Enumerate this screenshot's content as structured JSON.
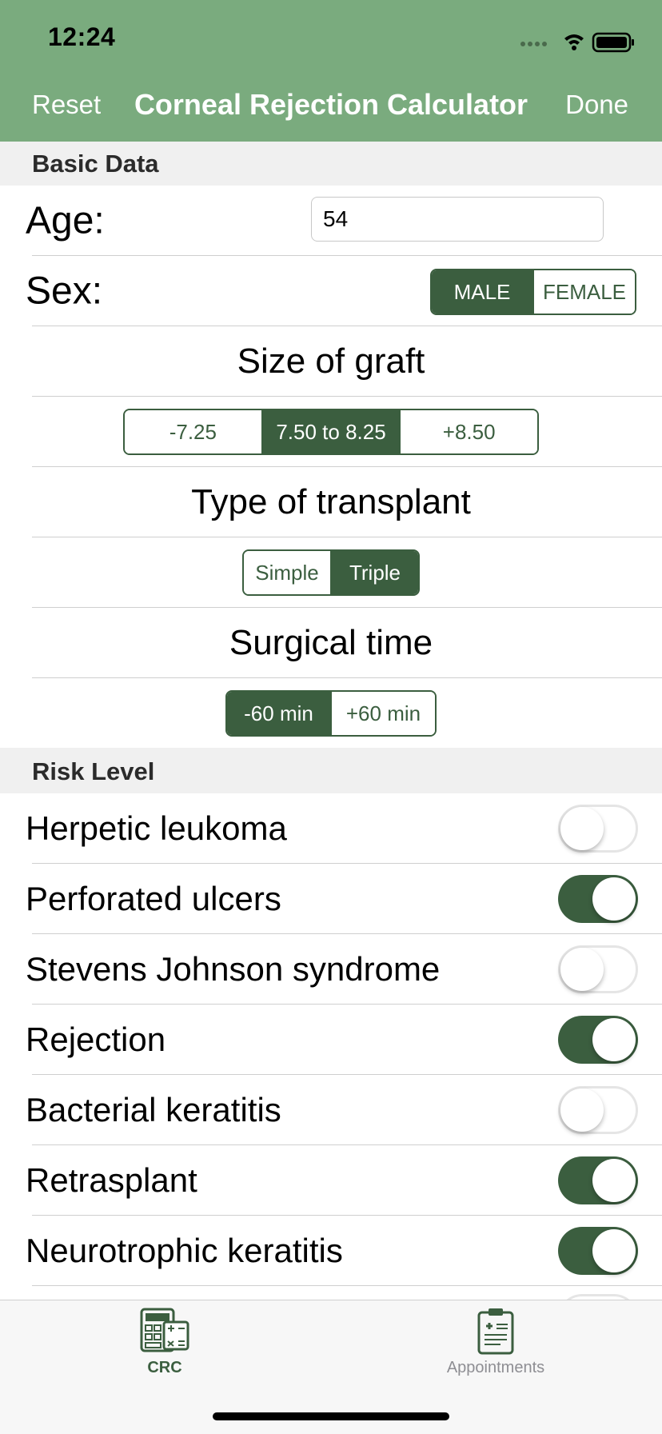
{
  "status_bar": {
    "time": "12:24"
  },
  "nav": {
    "reset_label": "Reset",
    "title": "Corneal Rejection Calculator",
    "done_label": "Done"
  },
  "basic_data": {
    "header": "Basic Data",
    "age": {
      "label": "Age:",
      "value": "54"
    },
    "sex": {
      "label": "Sex:",
      "options": [
        "MALE",
        "FEMALE"
      ],
      "selected": "MALE"
    },
    "graft_size": {
      "title": "Size of graft",
      "options": [
        "-7.25",
        "7.50 to 8.25",
        "+8.50"
      ],
      "selected": "7.50 to 8.25"
    },
    "transplant_type": {
      "title": "Type of transplant",
      "options": [
        "Simple",
        "Triple"
      ],
      "selected": "Triple"
    },
    "surgical_time": {
      "title": "Surgical time",
      "options": [
        "-60 min",
        "+60 min"
      ],
      "selected": "-60 min"
    }
  },
  "risk_level": {
    "header": "Risk Level",
    "items": [
      {
        "label": "Herpetic leukoma",
        "on": false
      },
      {
        "label": "Perforated ulcers",
        "on": true
      },
      {
        "label": "Stevens Johnson syndrome",
        "on": false
      },
      {
        "label": "Rejection",
        "on": true
      },
      {
        "label": "Bacterial keratitis",
        "on": false
      },
      {
        "label": "Retrasplant",
        "on": true
      },
      {
        "label": "Neurotrophic keratitis",
        "on": true
      }
    ]
  },
  "tab_bar": {
    "tabs": [
      {
        "label": "CRC",
        "icon": "calculator-icon",
        "active": true
      },
      {
        "label": "Appointments",
        "icon": "clipboard-icon",
        "active": false
      }
    ]
  },
  "colors": {
    "nav_green": "#7aab7e",
    "accent_dark_green": "#3b5e3f",
    "section_gray": "#f0f0f0"
  }
}
